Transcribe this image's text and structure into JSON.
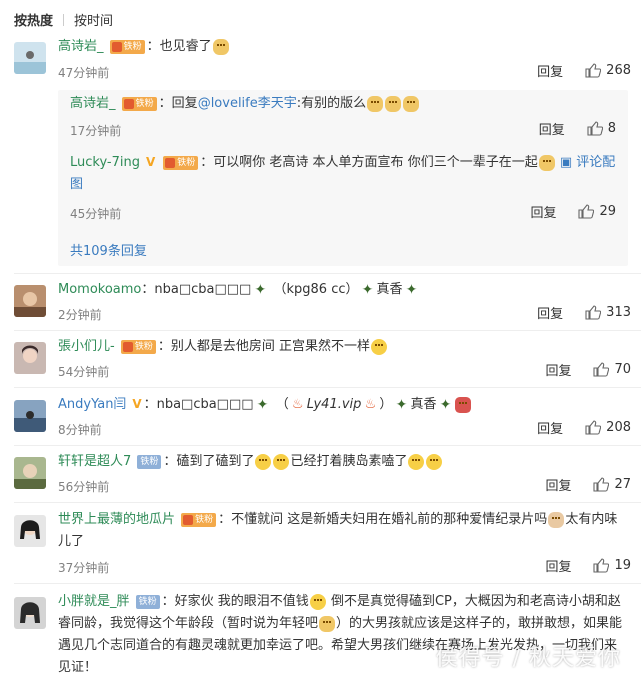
{
  "sort": {
    "hot": "按热度",
    "time": "按时间"
  },
  "reply_label": "回复",
  "comments": [
    {
      "user": "高诗岩_",
      "badge": "铁粉",
      "text": "：也见睿了",
      "time": "47分钟前",
      "likes": "268"
    },
    {
      "user": "Momokoamo",
      "text": "：nba□cba□□□",
      "text2": "（kpg86 cc）",
      "text3": "真香",
      "time": "2分钟前",
      "likes": "313"
    },
    {
      "user": "張小们儿-",
      "badge": "铁粉",
      "text": "：别人都是去他房间 正宫果然不一样",
      "time": "54分钟前",
      "likes": "70"
    },
    {
      "user": "AndyYan闫",
      "badge": "铁粉",
      "text": "：nba□cba□□□",
      "text2": "（",
      "text3": "Ly41.vip",
      "text4": "）",
      "text5": "真香",
      "time": "8分钟前",
      "likes": "208"
    },
    {
      "user": "轩轩是超人7",
      "badge": "铁粉",
      "text": "：磕到了磕到了",
      "text2": "已经打着胰岛素嗑了",
      "time": "56分钟前",
      "likes": "27"
    },
    {
      "user": "世界上最薄的地瓜片",
      "badge": "铁粉",
      "text": "：不懂就问 这是新婚夫妇用在婚礼前的那种爱情纪录片吗",
      "text2": "太有内味儿了",
      "time": "37分钟前",
      "likes": "19"
    },
    {
      "user": "小胖就是_胖",
      "badge": "铁粉",
      "text": "：好家伙 我的眼泪不值钱",
      "text2": "倒不是真觉得磕到CP，大概因为和老高诗小胡和赵睿同龄，我觉得这个年龄段（暂时说为年轻吧",
      "text3": "）的大男孩就应该是这样子的，敢拼敢想，如果能遇见几个志同道合的有趣灵魂就更加幸运了吧。希望大男孩们继续在赛场上发光发热，一切我们来见证！"
    }
  ],
  "replies": [
    {
      "user": "高诗岩_",
      "badge": "铁粉",
      "text": "：回复",
      "mention": "@lovelife李天宇",
      "text2": ":有别的版么",
      "time": "17分钟前",
      "likes": "8"
    },
    {
      "user": "Lucky-7ing",
      "badge": "铁粉",
      "text": "：可以啊你 老高诗 本人单方面宣布 你们三个一辈子在一起",
      "comment_pic": "评论配图",
      "time": "45分钟前",
      "likes": "29"
    }
  ],
  "more_replies": "共109条回复",
  "watermark": "侯得号 / 秋天爱你",
  "colors": {
    "username": "#2e8b57",
    "link": "#3a7bbf",
    "badge": "#f3a94a",
    "muted": "#808080"
  }
}
